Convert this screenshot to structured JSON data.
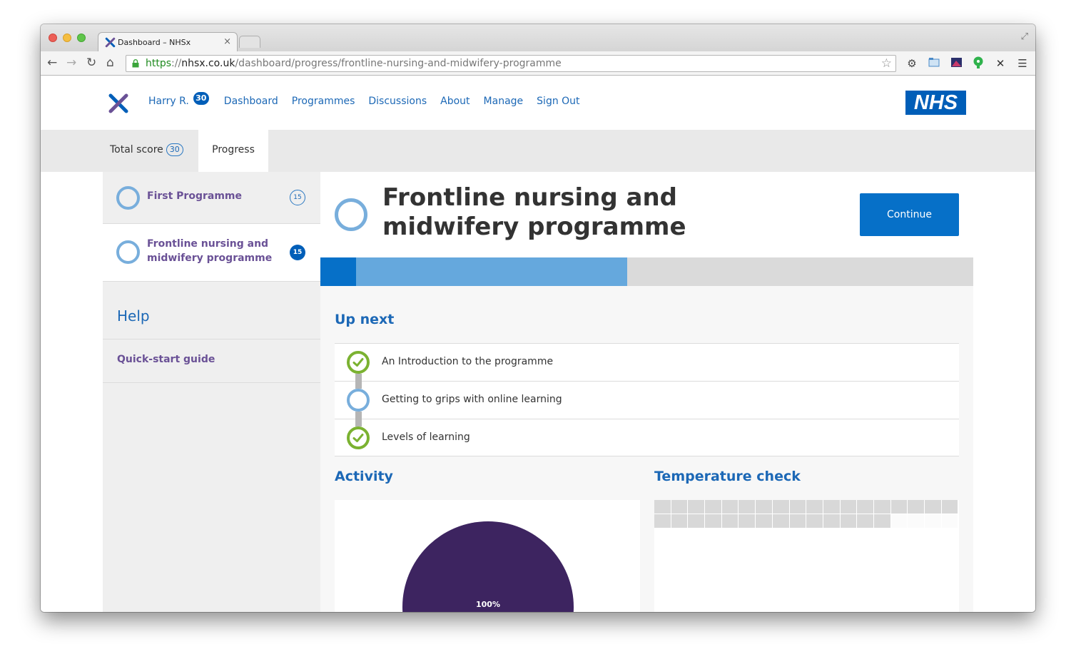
{
  "browser": {
    "tab_title": "Dashboard – NHSx",
    "tab_close": "×",
    "url_scheme": "https",
    "url_sep": "://",
    "url_host": "nhsx.co.uk",
    "url_path": "/dashboard/progress/frontline-nursing-and-midwifery-programme"
  },
  "header": {
    "user_name": "Harry R.",
    "user_score": "30",
    "nav": [
      "Dashboard",
      "Programmes",
      "Discussions",
      "About",
      "Manage",
      "Sign Out"
    ],
    "brand_logo": "NHS"
  },
  "subnav": {
    "total_score_label": "Total score",
    "total_score_value": "30",
    "progress_label": "Progress"
  },
  "sidebar": {
    "programmes": [
      {
        "title": "First Programme",
        "score": "15"
      },
      {
        "title": "Frontline nursing and midwifery programme",
        "score": "15"
      }
    ],
    "help_title": "Help",
    "help_links": [
      "Quick-start guide"
    ]
  },
  "main": {
    "title": "Frontline nursing and midwifery programme",
    "continue_label": "Continue",
    "progress": {
      "completed_fraction": 0.055,
      "current_fraction": 0.415
    },
    "up_next_title": "Up next",
    "up_next": [
      {
        "label": "An Introduction to the programme",
        "status": "complete"
      },
      {
        "label": "Getting to grips with online learning",
        "status": "incomplete"
      },
      {
        "label": "Levels of learning",
        "status": "complete"
      }
    ],
    "activity_title": "Activity",
    "temperature_title": "Temperature check"
  },
  "chart_data": {
    "type": "pie",
    "values": [
      100
    ],
    "labels": [
      "100%"
    ],
    "colors": [
      "#3d2460"
    ]
  },
  "temperature_check": {
    "filled_cells": 32,
    "total_cells": 36
  },
  "colors": {
    "nhs_blue": "#005eb8",
    "link_blue": "#1c68b6",
    "purple": "#6a5196",
    "ring_blue": "#78aedc",
    "check_green": "#7bb231"
  }
}
